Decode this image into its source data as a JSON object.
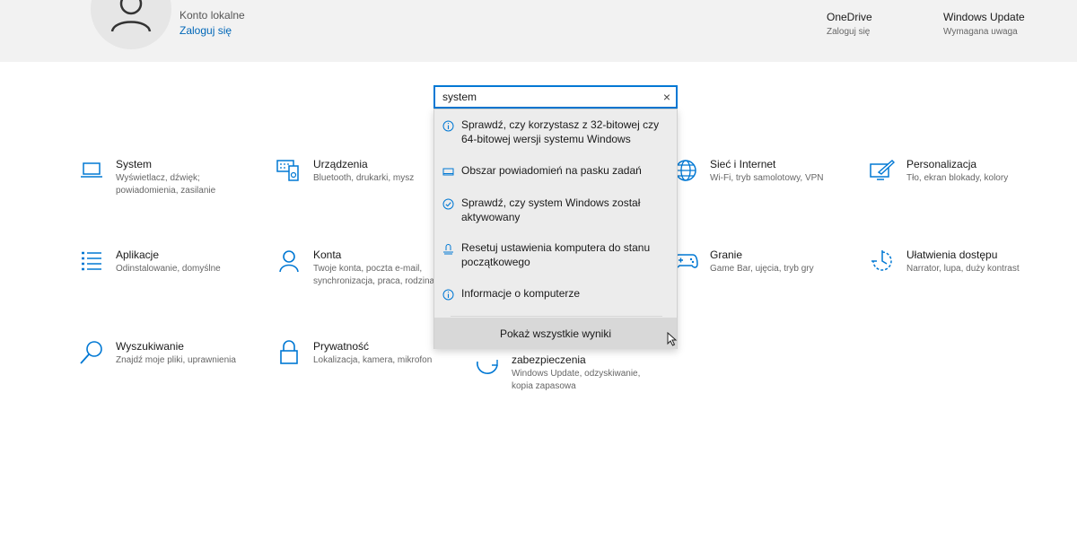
{
  "header": {
    "account_type": "Konto lokalne",
    "sign_in_link": "Zaloguj się",
    "onedrive": {
      "title": "OneDrive",
      "subtitle": "Zaloguj się"
    },
    "windows_update": {
      "title": "Windows Update",
      "subtitle": "Wymagana uwaga"
    }
  },
  "search": {
    "value": "system",
    "clear_glyph": "×",
    "suggestions": [
      {
        "icon": "info-icon",
        "label": "Sprawdź, czy korzystasz z 32-bitowej czy 64-bitowej wersji systemu Windows"
      },
      {
        "icon": "notification-area-icon",
        "label": "Obszar powiadomień na pasku zadań"
      },
      {
        "icon": "check-circle-icon",
        "label": "Sprawdź, czy system Windows został aktywowany"
      },
      {
        "icon": "reset-pc-icon",
        "label": "Resetuj ustawienia komputera do stanu początkowego"
      },
      {
        "icon": "info-icon",
        "label": "Informacje o komputerze"
      }
    ],
    "show_all_label": "Pokaż wszystkie wyniki"
  },
  "categories": [
    {
      "title": "System",
      "desc": "Wyświetlacz, dźwięk; powiadomienia, zasilanie",
      "icon": "laptop-icon"
    },
    {
      "title": "Urządzenia",
      "desc": "Bluetooth, drukarki, mysz",
      "icon": "devices-icon"
    },
    {
      "title": "Sieć i Internet",
      "desc": "Wi-Fi, tryb samolotowy, VPN",
      "icon": "globe-icon"
    },
    {
      "title": "Personalizacja",
      "desc": "Tło, ekran blokady, kolory",
      "icon": "paint-icon"
    },
    {
      "title": "Aplikacje",
      "desc": "Odinstalowanie, domyślne",
      "icon": "apps-list-icon"
    },
    {
      "title": "Konta",
      "desc": "Twoje konta, poczta e-mail, synchronizacja, praca, rodzina",
      "icon": "person-icon"
    },
    {
      "title": "Granie",
      "desc": "Game Bar, ujęcia, tryb gry",
      "icon": "gamepad-icon"
    },
    {
      "title": "Ułatwienia dostępu",
      "desc": "Narrator, lupa, duży kontrast",
      "icon": "accessibility-icon"
    },
    {
      "title": "Wyszukiwanie",
      "desc": "Znajdź moje pliki, uprawnienia",
      "icon": "search-icon"
    },
    {
      "title": "Prywatność",
      "desc": "Lokalizacja, kamera, mikrofon",
      "icon": "lock-icon"
    },
    {
      "title": "zabezpieczenia",
      "desc": "Windows Update, odzyskiwanie, kopia zapasowa",
      "icon": "update-icon"
    }
  ],
  "colors": {
    "accent": "#0078d4",
    "link": "#0067b8",
    "header_bg": "#f2f2f2",
    "dropdown_bg": "#ececec"
  }
}
